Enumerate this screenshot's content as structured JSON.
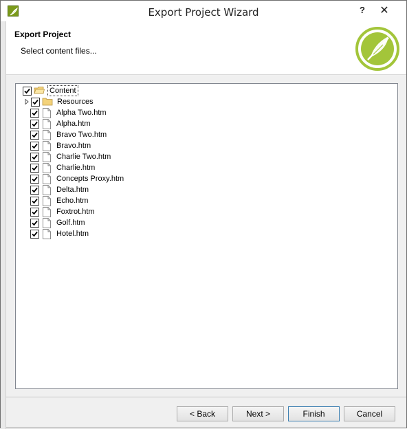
{
  "window": {
    "title": "Export Project Wizard",
    "help_label": "?",
    "close_label": "✕"
  },
  "header": {
    "title": "Export Project",
    "subtitle": "Select content files..."
  },
  "tree": {
    "root": {
      "label": "Content",
      "checked": true
    },
    "items": [
      {
        "label": "Resources",
        "type": "folder",
        "checked": true,
        "expandable": true
      },
      {
        "label": "Alpha Two.htm",
        "type": "file",
        "checked": true
      },
      {
        "label": "Alpha.htm",
        "type": "file",
        "checked": true
      },
      {
        "label": "Bravo Two.htm",
        "type": "file",
        "checked": true
      },
      {
        "label": "Bravo.htm",
        "type": "file",
        "checked": true
      },
      {
        "label": "Charlie Two.htm",
        "type": "file",
        "checked": true
      },
      {
        "label": "Charlie.htm",
        "type": "file",
        "checked": true
      },
      {
        "label": "Concepts Proxy.htm",
        "type": "file",
        "checked": true
      },
      {
        "label": "Delta.htm",
        "type": "file",
        "checked": true
      },
      {
        "label": "Echo.htm",
        "type": "file",
        "checked": true
      },
      {
        "label": "Foxtrot.htm",
        "type": "file",
        "checked": true
      },
      {
        "label": "Golf.htm",
        "type": "file",
        "checked": true
      },
      {
        "label": "Hotel.htm",
        "type": "file",
        "checked": true
      }
    ]
  },
  "buttons": {
    "back": "< Back",
    "next": "Next >",
    "finish": "Finish",
    "cancel": "Cancel"
  },
  "colors": {
    "brand_green": "#a3c53a",
    "folder": "#e8c86a"
  }
}
